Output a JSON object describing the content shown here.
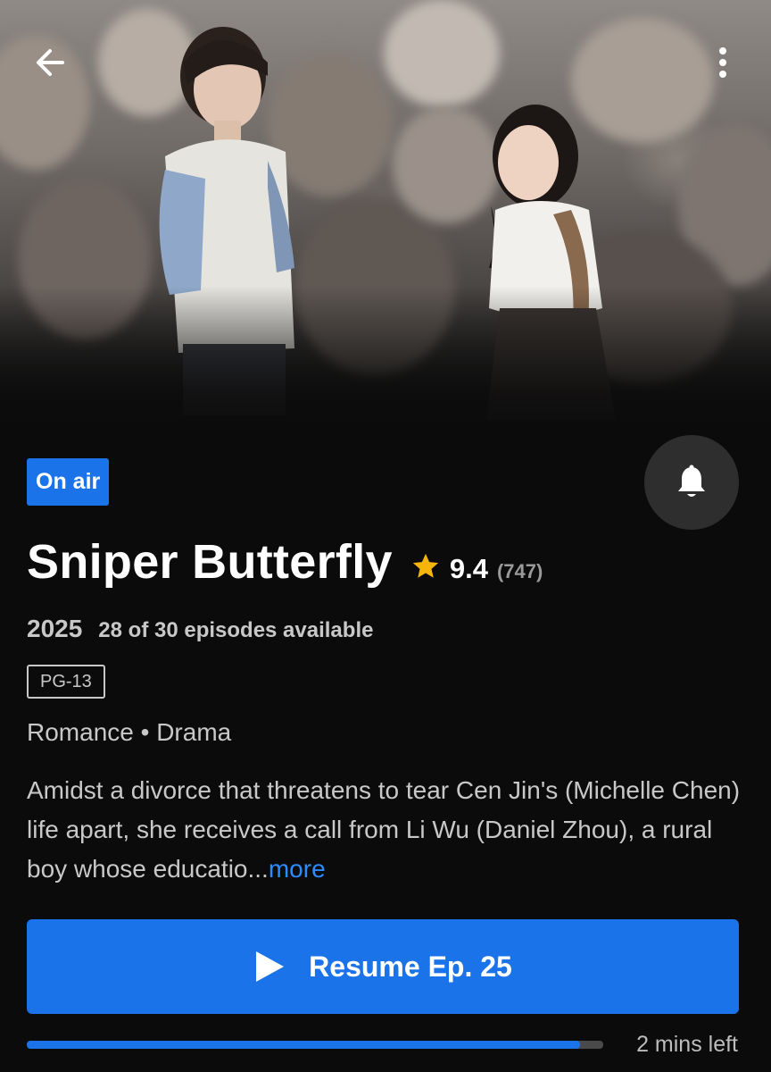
{
  "header": {
    "back_icon": "arrow-left-icon",
    "menu_icon": "more-vertical-icon"
  },
  "show": {
    "status": "On air",
    "title": "Sniper Butterfly",
    "rating": "9.4",
    "rating_count": "(747)",
    "year": "2025",
    "episodes": "28 of 30 episodes available",
    "content_rating": "PG-13",
    "genres": "Romance • Drama",
    "synopsis": "Amidst a divorce that threatens to tear Cen Jin's (Michelle Chen) life apart, she receives a call from Li Wu (Daniel Zhou), a rural boy whose educatio...",
    "more_label": "more"
  },
  "actions": {
    "notify_icon": "bell-icon",
    "resume_label": "Resume Ep. 25",
    "play_icon": "play-icon"
  },
  "progress": {
    "fraction": 0.96,
    "time_left": "2 mins left"
  },
  "colors": {
    "accent": "#1a73e8",
    "link": "#2b8cff",
    "star": "#f5b50a",
    "background": "#0b0b0b"
  }
}
